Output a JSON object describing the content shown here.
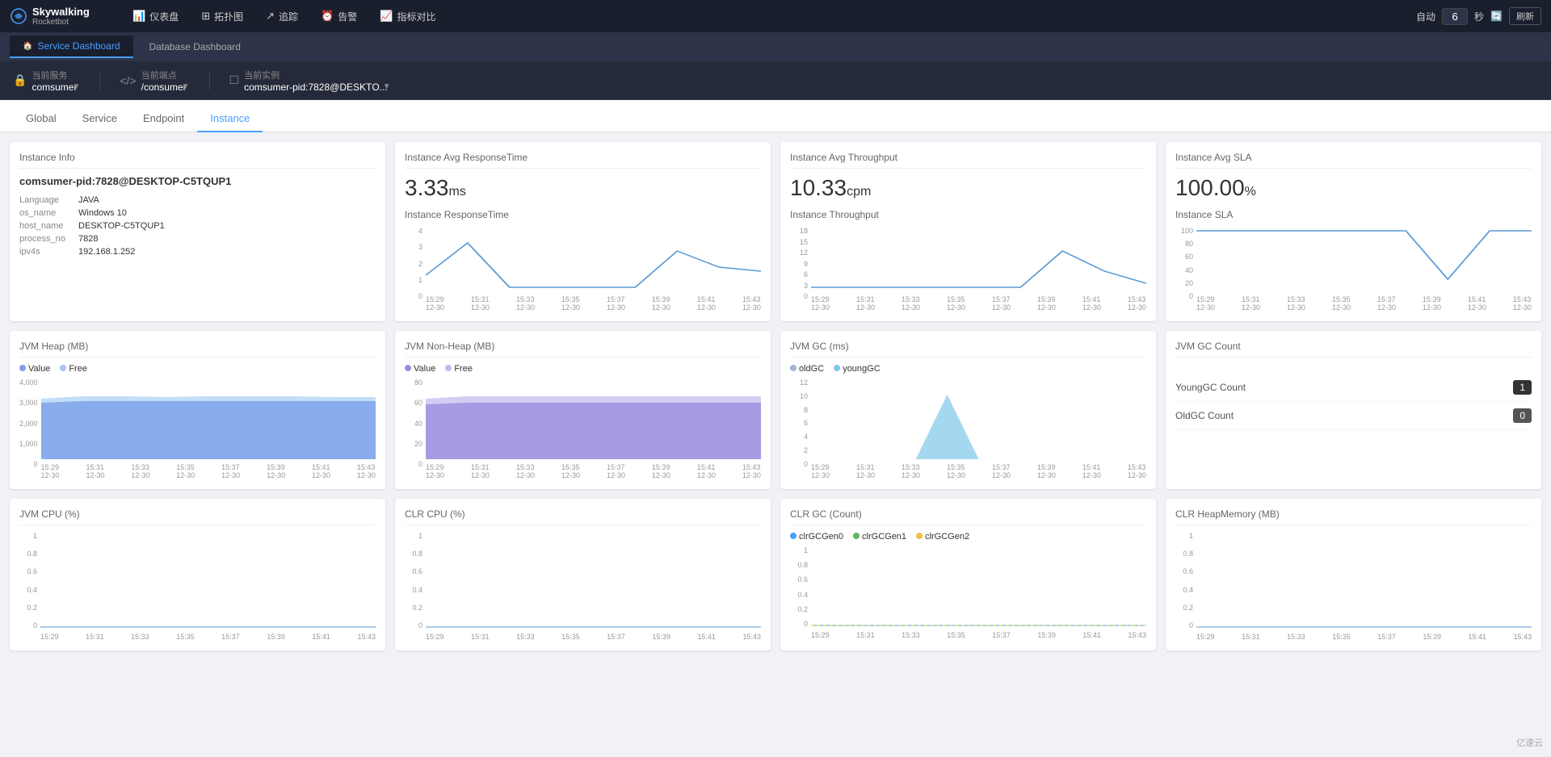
{
  "brand": {
    "logo_text": "Skywalking",
    "sub_text": "Rocketbot"
  },
  "top_nav": {
    "items": [
      {
        "id": "dashboard",
        "icon": "📊",
        "label": "仪表盘"
      },
      {
        "id": "topology",
        "icon": "⊞",
        "label": "拓扑图"
      },
      {
        "id": "trace",
        "icon": "↗",
        "label": "追踪"
      },
      {
        "id": "alarm",
        "icon": "⏰",
        "label": "告警"
      },
      {
        "id": "metrics",
        "icon": "📈",
        "label": "指标对比"
      }
    ],
    "auto_label": "自动",
    "auto_value": "6",
    "seconds_label": "秒",
    "refresh_label": "刷新"
  },
  "dashboard_tabs": [
    {
      "id": "service",
      "label": "Service Dashboard",
      "active": true
    },
    {
      "id": "database",
      "label": "Database Dashboard",
      "active": false
    }
  ],
  "controls": {
    "service_label": "当前服务",
    "service_value": "comsumer",
    "endpoint_label": "当前端点",
    "endpoint_value": "/consumer",
    "instance_label": "当前实例",
    "instance_value": "comsumer-pid:7828@DESKTО..."
  },
  "page_tabs": [
    {
      "id": "global",
      "label": "Global"
    },
    {
      "id": "service",
      "label": "Service"
    },
    {
      "id": "endpoint",
      "label": "Endpoint"
    },
    {
      "id": "instance",
      "label": "Instance",
      "active": true
    }
  ],
  "instance_info": {
    "title": "Instance Info",
    "name": "comsumer-pid:7828@DESKTOP-C5TQUP1",
    "fields": [
      {
        "key": "Language",
        "value": "JAVA"
      },
      {
        "key": "os_name",
        "value": "Windows 10"
      },
      {
        "key": "host_name",
        "value": "DESKTOP-C5TQUP1"
      },
      {
        "key": "process_no",
        "value": "7828"
      },
      {
        "key": "ipv4s",
        "value": "192.168.1.252"
      }
    ]
  },
  "avg_response": {
    "title": "Instance Avg ResponseTime",
    "value": "3.33",
    "unit": "ms",
    "chart_title": "Instance ResponseTime",
    "y_labels": [
      "4",
      "3",
      "2",
      "1",
      "0"
    ],
    "x_labels": [
      "15:29\n12-30",
      "15:31\n12-30",
      "15:33\n12-30",
      "15:35\n12-30",
      "15:37\n12-30",
      "15:39\n12-30",
      "15:41\n12-30",
      "15:43\n12-30"
    ]
  },
  "avg_throughput": {
    "title": "Instance Avg Throughput",
    "value": "10.33",
    "unit": "cpm",
    "chart_title": "Instance Throughput",
    "y_labels": [
      "18",
      "15",
      "12",
      "9",
      "6",
      "3",
      "0"
    ],
    "x_labels": [
      "15:29\n12-30",
      "15:31\n12-30",
      "15:33\n12-30",
      "15:35\n12-30",
      "15:37\n12-30",
      "15:39\n12-30",
      "15:41\n12-30",
      "15:43\n12-30"
    ]
  },
  "avg_sla": {
    "title": "Instance Avg SLA",
    "value": "100.00",
    "unit": "%",
    "chart_title": "Instance SLA",
    "y_labels": [
      "100",
      "80",
      "60",
      "40",
      "20",
      "0"
    ],
    "x_labels": [
      "15:29\n12-30",
      "15:31\n12-30",
      "15:33\n12-30",
      "15:35\n12-30",
      "15:37\n12-30",
      "15:39\n12-30",
      "15:41\n12-30",
      "15:43\n12-30"
    ]
  },
  "jvm_heap": {
    "title": "JVM Heap (MB)",
    "legend": [
      {
        "label": "Value",
        "color": "#7b9fe8"
      },
      {
        "label": "Free",
        "color": "#a8c4f0"
      }
    ],
    "y_labels": [
      "4,000",
      "3,000",
      "2,000",
      "1,000",
      "0"
    ],
    "x_labels": [
      "15:29\n12-30",
      "15:31\n12-30",
      "15:33\n12-30",
      "15:35\n12-30",
      "15:37\n12-30",
      "15:39\n12-30",
      "15:41\n12-30",
      "15:43\n12-30"
    ]
  },
  "jvm_nonheap": {
    "title": "JVM Non-Heap (MB)",
    "legend": [
      {
        "label": "Value",
        "color": "#9b8fde"
      },
      {
        "label": "Free",
        "color": "#c0b8f0"
      }
    ],
    "y_labels": [
      "80",
      "60",
      "40",
      "20",
      "0"
    ],
    "x_labels": [
      "15:29\n12-30",
      "15:31\n12-30",
      "15:33\n12-30",
      "15:35\n12-30",
      "15:37\n12-30",
      "15:39\n12-30",
      "15:41\n12-30",
      "15:43\n12-30"
    ]
  },
  "jvm_gc": {
    "title": "JVM GC (ms)",
    "legend": [
      {
        "label": "oldGC",
        "color": "#a0b4d8"
      },
      {
        "label": "youngGC",
        "color": "#7ec8e8"
      }
    ],
    "y_labels": [
      "12",
      "10",
      "8",
      "6",
      "4",
      "2",
      "0"
    ],
    "x_labels": [
      "15:29\n12-30",
      "15:31\n12-30",
      "15:33\n12-30",
      "15:35\n12-30",
      "15:37\n12-30",
      "15:39\n12-30",
      "15:41\n12-30",
      "15:43\n12-30"
    ]
  },
  "jvm_gc_count": {
    "title": "JVM GC Count",
    "items": [
      {
        "label": "YoungGC Count",
        "value": "1"
      },
      {
        "label": "OldGC Count",
        "value": "0"
      }
    ]
  },
  "jvm_cpu": {
    "title": "JVM CPU (%)",
    "y_labels": [
      "1",
      "0.8",
      "0.6",
      "0.4",
      "0.2",
      "0"
    ],
    "x_labels": [
      "15:29",
      "15:31",
      "15:33",
      "15:35",
      "15:37",
      "15:39",
      "15:41",
      "15:43"
    ]
  },
  "clr_cpu": {
    "title": "CLR CPU (%)",
    "y_labels": [
      "1",
      "0.8",
      "0.6",
      "0.4",
      "0.2",
      "0"
    ],
    "x_labels": [
      "15:29",
      "15:31",
      "15:33",
      "15:35",
      "15:37",
      "15:39",
      "15:41",
      "15:43"
    ]
  },
  "clr_gc": {
    "title": "CLR GC (Count)",
    "legend": [
      {
        "label": "clrGCGen0",
        "color": "#4a9eff"
      },
      {
        "label": "clrGCGen1",
        "color": "#5cb85c"
      },
      {
        "label": "clrGCGen2",
        "color": "#f0c040"
      }
    ],
    "y_labels": [
      "1",
      "0.8",
      "0.6",
      "0.4",
      "0.2",
      "0"
    ],
    "x_labels": [
      "15:29",
      "15:31",
      "15:33",
      "15:35",
      "15:37",
      "15:39",
      "15:41",
      "15:43"
    ]
  },
  "clr_heapmemory": {
    "title": "CLR HeapMemory (MB)",
    "y_labels": [
      "1",
      "0.8",
      "0.6",
      "0.4",
      "0.2",
      "0"
    ],
    "x_labels": [
      "15:29",
      "15:31",
      "15:33",
      "15:35",
      "15:37",
      "15:39",
      "15:41",
      "15:43"
    ]
  },
  "watermark": "亿速云"
}
